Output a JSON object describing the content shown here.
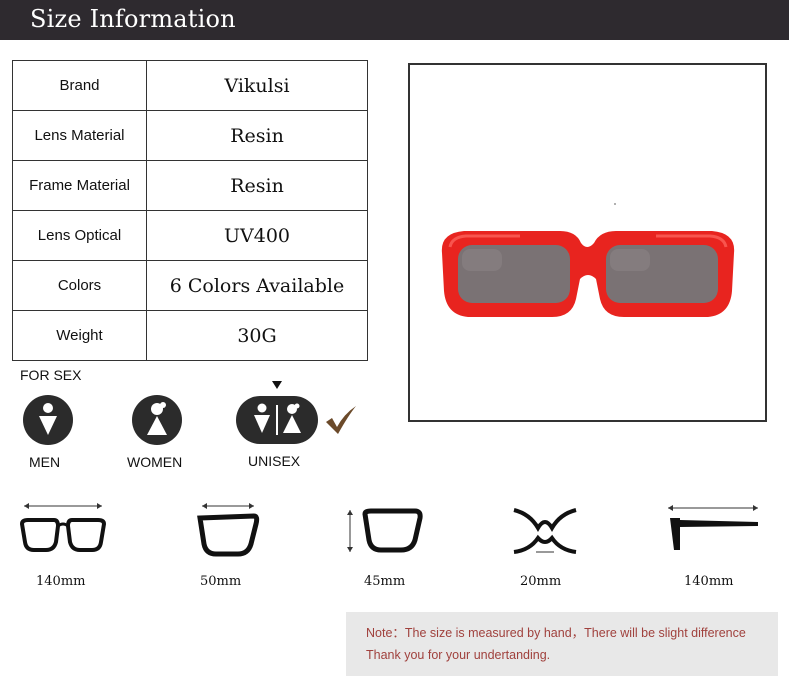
{
  "header": {
    "title": "Size Information"
  },
  "specs": [
    {
      "key": "Brand",
      "value": "Vikulsi"
    },
    {
      "key": "Lens Material",
      "value": "Resin"
    },
    {
      "key": "Frame Material",
      "value": "Resin"
    },
    {
      "key": "Lens Optical",
      "value": "UV400"
    },
    {
      "key": "Colors",
      "value": "6 Colors Available"
    },
    {
      "key": "Weight",
      "value": "30G"
    }
  ],
  "sex": {
    "title": "FOR SEX",
    "men": "MEN",
    "women": "WOMEN",
    "unisex": "UNISEX",
    "selected": "UNISEX"
  },
  "measurements": [
    {
      "value": "140mm",
      "icon": "frame-width-icon"
    },
    {
      "value": "50mm",
      "icon": "lens-width-icon"
    },
    {
      "value": "45mm",
      "icon": "lens-height-icon"
    },
    {
      "value": "20mm",
      "icon": "bridge-width-icon"
    },
    {
      "value": "140mm",
      "icon": "temple-length-icon"
    }
  ],
  "note": {
    "line1": "Note：The size is measured by hand，There will be slight difference",
    "line2": "Thank you for your undertanding."
  },
  "colors": {
    "header_bg": "#2e2a2f",
    "frame_red": "#e8241f",
    "note_text": "#a0413d",
    "check": "#6b4a2a"
  }
}
